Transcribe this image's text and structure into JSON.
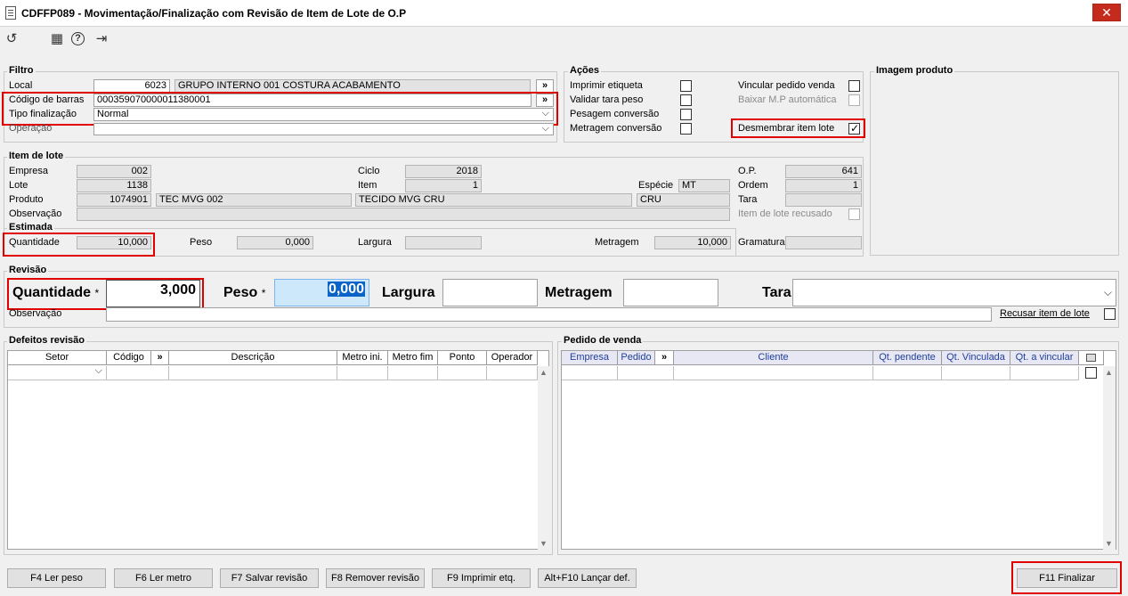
{
  "window": {
    "title": "CDFFP089 - Movimentação/Finalização com Revisão de Item de Lote de O.P",
    "close_glyph": "✕"
  },
  "toolbar": [
    {
      "name": "refresh-icon",
      "glyph": "↺"
    },
    {
      "name": "calendar-icon",
      "glyph": "▦"
    },
    {
      "name": "help-icon",
      "glyph": "?"
    },
    {
      "name": "exit-icon",
      "glyph": "⇥"
    }
  ],
  "filtro": {
    "title": "Filtro",
    "local_label": "Local",
    "local_code": "6023",
    "local_desc": "GRUPO INTERNO 001 COSTURA ACABAMENTO",
    "codigo_label": "Código de barras",
    "codigo_value": "000359070000011380001",
    "tipo_label": "Tipo finalização",
    "tipo_value": "Normal",
    "operacao_label": "Operação",
    "operacao_value": "",
    "more_glyph": "»",
    "dropdown_glyph": "⌵"
  },
  "acoes": {
    "title": "Ações",
    "items": [
      {
        "label": "Imprimir etiqueta",
        "checked": false,
        "disabled": false
      },
      {
        "label": "Validar tara peso",
        "checked": false,
        "disabled": false
      },
      {
        "label": "Pesagem conversão",
        "checked": false,
        "disabled": false
      },
      {
        "label": "Metragem conversão",
        "checked": false,
        "disabled": false
      }
    ],
    "items2": [
      {
        "label": "Vincular pedido venda",
        "checked": false,
        "disabled": false
      },
      {
        "label": "Baixar M.P automática",
        "checked": false,
        "disabled": true
      },
      {
        "label": "Desmembrar item lote",
        "checked": true,
        "disabled": false
      }
    ]
  },
  "imagem": {
    "title": "Imagem produto"
  },
  "item_lote": {
    "title": "Item de lote",
    "empresa_label": "Empresa",
    "empresa": "002",
    "lote_label": "Lote",
    "lote": "1138",
    "produto_label": "Produto",
    "produto_code": "1074901",
    "produto_desc": "TEC MVG 002",
    "observacao_label": "Observação",
    "observacao": "",
    "ciclo_label": "Ciclo",
    "ciclo": "2018",
    "item_label": "Item",
    "item": "1",
    "item_desc": "TECIDO MVG CRU",
    "especie_label": "Espécie",
    "especie": "MT",
    "unidade": "CRU",
    "op_label": "O.P.",
    "op": "641",
    "ordem_label": "Ordem",
    "ordem": "1",
    "tara_label": "Tara",
    "tara": "",
    "recusado_label": "Item de lote recusado",
    "estimada_title": "Estimada",
    "quantidade_label": "Quantidade",
    "quantidade": "10,000",
    "peso_label": "Peso",
    "peso": "0,000",
    "largura_label": "Largura",
    "largura": "",
    "metragem_label": "Metragem",
    "metragem": "10,000",
    "gramatura_label": "Gramatura",
    "gramatura": ""
  },
  "revisao": {
    "title": "Revisão",
    "quantidade_label": "Quantidade",
    "quantidade": "3,000",
    "peso_label": "Peso",
    "peso": "0,000",
    "largura_label": "Largura",
    "largura": "",
    "metragem_label": "Metragem",
    "metragem": "",
    "tara_label": "Tara",
    "tara": "",
    "required_mark": "*",
    "observacao_label": "Observação",
    "observacao": "",
    "recusar_label": "Recusar item de lote"
  },
  "defeitos": {
    "title": "Defeitos revisão",
    "columns": [
      "Setor",
      "Código",
      "»",
      "Descrição",
      "Metro ini.",
      "Metro fim",
      "Ponto",
      "Operador"
    ]
  },
  "pedido": {
    "title": "Pedido de venda",
    "columns": [
      "Empresa",
      "Pedido",
      "»",
      "Cliente",
      "Qt. pendente",
      "Qt. Vinculada",
      "Qt. a vincular"
    ]
  },
  "scroll": {
    "up": "▲",
    "down": "▼"
  },
  "footer": {
    "buttons": [
      "F4 Ler peso",
      "F6 Ler metro",
      "F7 Salvar revisão",
      "F8 Remover revisão",
      "F9 Imprimir etq.",
      "Alt+F10 Lançar def."
    ],
    "finalizar": "F11 Finalizar"
  }
}
